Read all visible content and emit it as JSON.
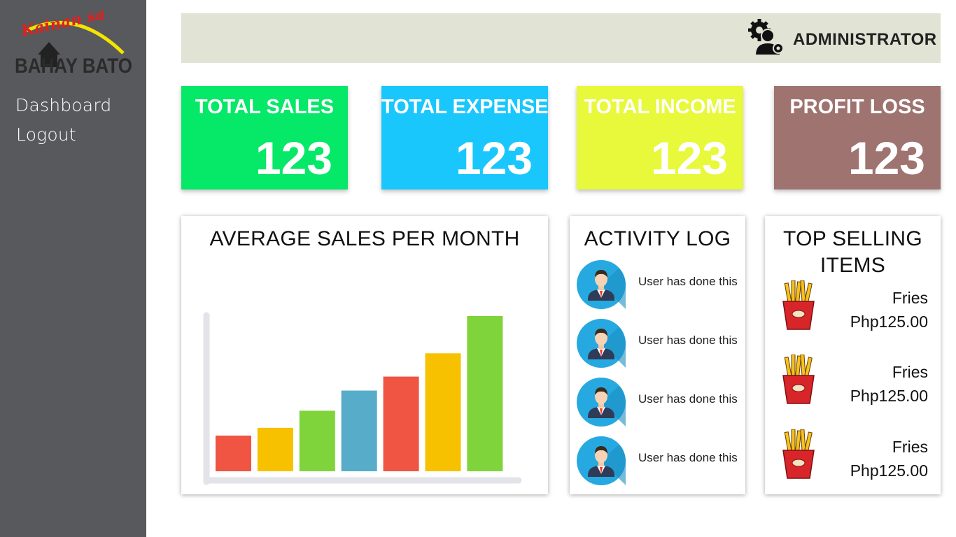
{
  "brand": {
    "logo_script": "Kainan sa",
    "logo_name": "BAHAY BATO"
  },
  "sidebar": {
    "items": [
      {
        "label": "Dashboard"
      },
      {
        "label": "Logout"
      }
    ]
  },
  "header": {
    "user_label": "ADMINISTRATOR",
    "user_icon": "admin-gear-user-icon"
  },
  "stats": [
    {
      "title": "TOTAL SALES",
      "value": "123",
      "color": "#05e868"
    },
    {
      "title": "TOTAL EXPENSE",
      "value": "123",
      "color": "#1ac7fc"
    },
    {
      "title": "TOTAL INCOME",
      "value": "123",
      "color": "#e8f83a"
    },
    {
      "title": "PROFIT LOSS",
      "value": "123",
      "color": "#9e7370"
    }
  ],
  "sales_chart": {
    "title": "AVERAGE SALES PER MONTH"
  },
  "chart_data": {
    "type": "bar",
    "title": "AVERAGE SALES PER MONTH",
    "categories": [
      "",
      "",
      "",
      "",
      "",
      "",
      ""
    ],
    "values": [
      23,
      28,
      39,
      52,
      61,
      76,
      100
    ],
    "colors": [
      "#f05443",
      "#f7c100",
      "#7ed43a",
      "#56acc9",
      "#f05443",
      "#f7c100",
      "#7ed43a"
    ],
    "ylim": [
      0,
      100
    ],
    "grid": false,
    "legend": "none",
    "xlabel": "",
    "ylabel": ""
  },
  "activity_log": {
    "title": "ACTIVITY LOG",
    "entries": [
      {
        "text": "User has done this",
        "icon": "user-avatar-icon"
      },
      {
        "text": "User has done this",
        "icon": "user-avatar-icon"
      },
      {
        "text": "User has done this",
        "icon": "user-avatar-icon"
      },
      {
        "text": "User has done this",
        "icon": "user-avatar-icon"
      }
    ]
  },
  "top_selling": {
    "title_line1": "TOP SELLING",
    "title_line2": "ITEMS",
    "items": [
      {
        "name": "Fries",
        "price": "Php125.00",
        "icon": "fries-icon"
      },
      {
        "name": "Fries",
        "price": "Php125.00",
        "icon": "fries-icon"
      },
      {
        "name": "Fries",
        "price": "Php125.00",
        "icon": "fries-icon"
      }
    ]
  }
}
